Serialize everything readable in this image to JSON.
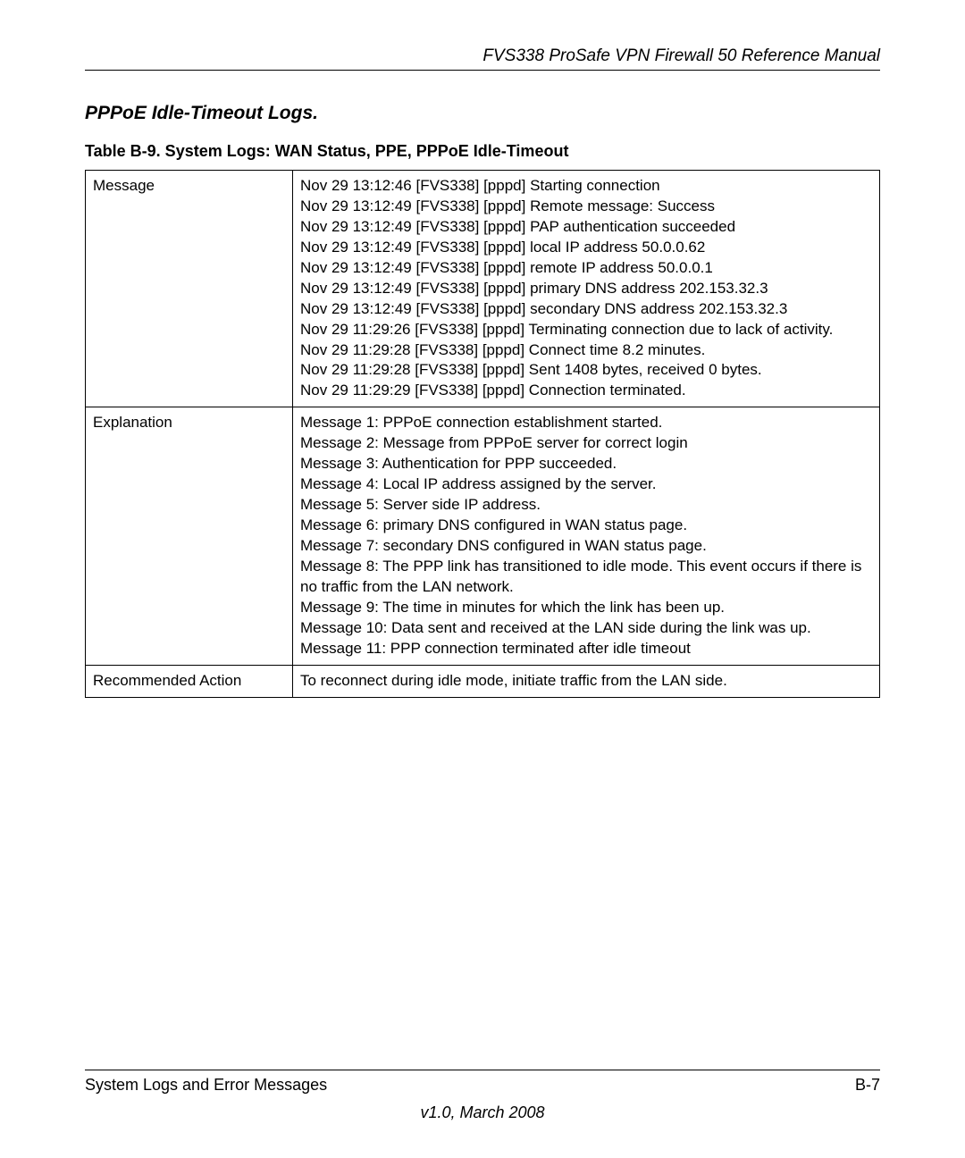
{
  "header": {
    "manual_title": "FVS338 ProSafe VPN Firewall 50 Reference Manual"
  },
  "section": {
    "title": "PPPoE Idle-Timeout Logs.",
    "table_caption": "Table B-9.  System Logs: WAN Status, PPE, PPPoE Idle-Timeout"
  },
  "table": {
    "rows": [
      {
        "label": "Message",
        "lines": [
          "Nov 29 13:12:46 [FVS338] [pppd] Starting connection",
          "Nov 29 13:12:49 [FVS338] [pppd] Remote message: Success",
          "Nov 29 13:12:49 [FVS338] [pppd] PAP authentication succeeded",
          "Nov 29 13:12:49 [FVS338] [pppd] local IP address 50.0.0.62",
          "Nov 29 13:12:49 [FVS338] [pppd] remote IP address 50.0.0.1",
          "Nov 29 13:12:49 [FVS338] [pppd] primary DNS address 202.153.32.3",
          "Nov 29 13:12:49 [FVS338] [pppd] secondary DNS address 202.153.32.3",
          "Nov 29 11:29:26 [FVS338] [pppd] Terminating connection due to lack of activity.",
          "Nov 29 11:29:28 [FVS338] [pppd] Connect time 8.2 minutes.",
          "Nov 29 11:29:28 [FVS338] [pppd] Sent 1408 bytes, received 0 bytes.",
          "Nov 29 11:29:29 [FVS338] [pppd] Connection terminated."
        ]
      },
      {
        "label": "Explanation",
        "lines": [
          "Message 1: PPPoE connection establishment started.",
          "Message 2: Message from PPPoE server for correct login",
          "Message 3: Authentication for PPP succeeded.",
          "Message 4: Local IP address assigned by the server.",
          "Message 5: Server side IP address.",
          "Message 6: primary DNS configured in WAN status page.",
          "Message 7: secondary DNS configured in WAN status page.",
          "Message 8: The PPP link has transitioned to idle mode. This event occurs if there is no traffic from the LAN network.",
          "Message 9: The time in minutes for which the link has been up.",
          "Message 10: Data sent and received at the LAN side during the link was up.",
          "Message 11: PPP connection terminated after idle timeout"
        ]
      },
      {
        "label": "Recommended Action",
        "lines": [
          "To reconnect during idle mode, initiate traffic from the LAN side."
        ]
      }
    ]
  },
  "footer": {
    "left": "System Logs and Error Messages",
    "right": "B-7",
    "version": "v1.0, March 2008"
  }
}
